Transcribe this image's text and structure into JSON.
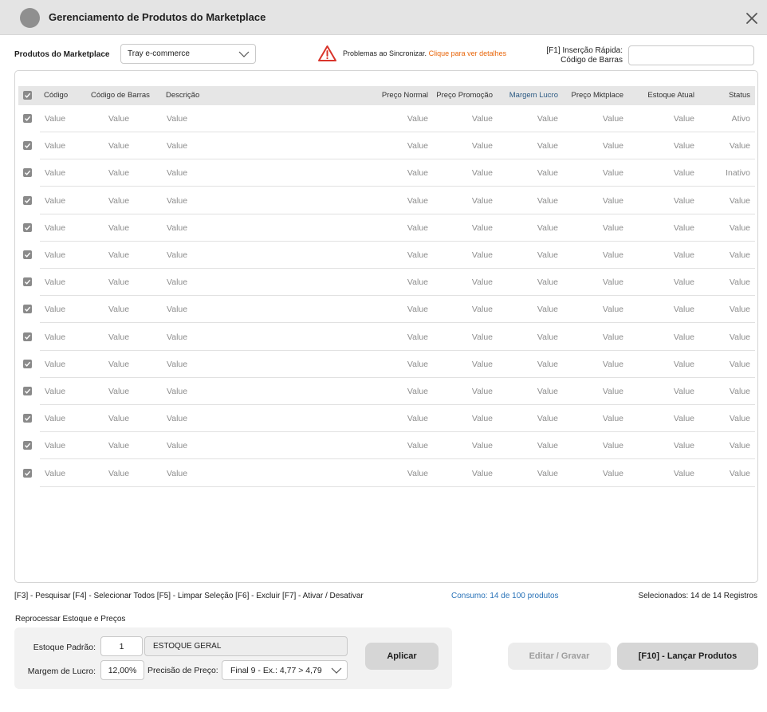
{
  "window": {
    "title": "Gerenciamento de Produtos do Marketplace"
  },
  "toolbar": {
    "marketplace_label": "Produtos do Marketplace",
    "marketplace_selected": "Tray e-commerce",
    "sync_warning": "Problemas ao Sincronizar.",
    "sync_link": "Clique para ver detalhes",
    "quick_insert_line1": "[F1] Inserção Rápida:",
    "quick_insert_line2": "Código de Barras",
    "quick_insert_value": ""
  },
  "table": {
    "columns": {
      "codigo": "Código",
      "codigo_barras": "Código de Barras",
      "descricao": "Descrição",
      "preco_normal": "Preço Normal",
      "preco_promocao": "Preço Promoção",
      "margem_lucro": "Margem Lucro",
      "preco_mktplace": "Preço Mktplace",
      "estoque_atual": "Estoque Atual",
      "status": "Status"
    },
    "rows": [
      {
        "checked": true,
        "codigo": "Value",
        "codigo_barras": "Value",
        "descricao": "Value",
        "preco_normal": "Value",
        "preco_promocao": "Value",
        "margem_lucro": "Value",
        "preco_mktplace": "Value",
        "estoque_atual": "Value",
        "status": "Ativo"
      },
      {
        "checked": true,
        "codigo": "Value",
        "codigo_barras": "Value",
        "descricao": "Value",
        "preco_normal": "Value",
        "preco_promocao": "Value",
        "margem_lucro": "Value",
        "preco_mktplace": "Value",
        "estoque_atual": "Value",
        "status": "Value"
      },
      {
        "checked": true,
        "codigo": "Value",
        "codigo_barras": "Value",
        "descricao": "Value",
        "preco_normal": "Value",
        "preco_promocao": "Value",
        "margem_lucro": "Value",
        "preco_mktplace": "Value",
        "estoque_atual": "Value",
        "status": "Inativo"
      },
      {
        "checked": true,
        "codigo": "Value",
        "codigo_barras": "Value",
        "descricao": "Value",
        "preco_normal": "Value",
        "preco_promocao": "Value",
        "margem_lucro": "Value",
        "preco_mktplace": "Value",
        "estoque_atual": "Value",
        "status": "Value"
      },
      {
        "checked": true,
        "codigo": "Value",
        "codigo_barras": "Value",
        "descricao": "Value",
        "preco_normal": "Value",
        "preco_promocao": "Value",
        "margem_lucro": "Value",
        "preco_mktplace": "Value",
        "estoque_atual": "Value",
        "status": "Value"
      },
      {
        "checked": true,
        "codigo": "Value",
        "codigo_barras": "Value",
        "descricao": "Value",
        "preco_normal": "Value",
        "preco_promocao": "Value",
        "margem_lucro": "Value",
        "preco_mktplace": "Value",
        "estoque_atual": "Value",
        "status": "Value"
      },
      {
        "checked": true,
        "codigo": "Value",
        "codigo_barras": "Value",
        "descricao": "Value",
        "preco_normal": "Value",
        "preco_promocao": "Value",
        "margem_lucro": "Value",
        "preco_mktplace": "Value",
        "estoque_atual": "Value",
        "status": "Value"
      },
      {
        "checked": true,
        "codigo": "Value",
        "codigo_barras": "Value",
        "descricao": "Value",
        "preco_normal": "Value",
        "preco_promocao": "Value",
        "margem_lucro": "Value",
        "preco_mktplace": "Value",
        "estoque_atual": "Value",
        "status": "Value"
      },
      {
        "checked": true,
        "codigo": "Value",
        "codigo_barras": "Value",
        "descricao": "Value",
        "preco_normal": "Value",
        "preco_promocao": "Value",
        "margem_lucro": "Value",
        "preco_mktplace": "Value",
        "estoque_atual": "Value",
        "status": "Value"
      },
      {
        "checked": true,
        "codigo": "Value",
        "codigo_barras": "Value",
        "descricao": "Value",
        "preco_normal": "Value",
        "preco_promocao": "Value",
        "margem_lucro": "Value",
        "preco_mktplace": "Value",
        "estoque_atual": "Value",
        "status": "Value"
      },
      {
        "checked": true,
        "codigo": "Value",
        "codigo_barras": "Value",
        "descricao": "Value",
        "preco_normal": "Value",
        "preco_promocao": "Value",
        "margem_lucro": "Value",
        "preco_mktplace": "Value",
        "estoque_atual": "Value",
        "status": "Value"
      },
      {
        "checked": true,
        "codigo": "Value",
        "codigo_barras": "Value",
        "descricao": "Value",
        "preco_normal": "Value",
        "preco_promocao": "Value",
        "margem_lucro": "Value",
        "preco_mktplace": "Value",
        "estoque_atual": "Value",
        "status": "Value"
      },
      {
        "checked": true,
        "codigo": "Value",
        "codigo_barras": "Value",
        "descricao": "Value",
        "preco_normal": "Value",
        "preco_promocao": "Value",
        "margem_lucro": "Value",
        "preco_mktplace": "Value",
        "estoque_atual": "Value",
        "status": "Value"
      },
      {
        "checked": true,
        "codigo": "Value",
        "codigo_barras": "Value",
        "descricao": "Value",
        "preco_normal": "Value",
        "preco_promocao": "Value",
        "margem_lucro": "Value",
        "preco_mktplace": "Value",
        "estoque_atual": "Value",
        "status": "Value"
      }
    ]
  },
  "footer": {
    "shortcuts": "[F3] - Pesquisar  [F4] - Selecionar Todos  [F5] - Limpar Seleção  [F6] - Excluir  [F7] - Ativar / Desativar",
    "consumo": "Consumo: 14 de 100 produtos",
    "selecionados": "Selecionados: 14 de 14 Registros"
  },
  "reprocess": {
    "title": "Reprocessar Estoque e Preços",
    "estoque_label": "Estoque Padrão:",
    "estoque_code": "1",
    "estoque_name": "ESTOQUE GERAL",
    "margem_label": "Margem de Lucro:",
    "margem_value": "12,00%",
    "precisao_label": "Precisão de Preço:",
    "precisao_selected": "Final 9 - Ex.: 4,77 > 4,79",
    "aplicar_label": "Aplicar"
  },
  "actions": {
    "editar_label": "Editar / Gravar",
    "lancar_label": "[F10] - Lançar Produtos"
  },
  "colors": {
    "warning_red": "#d9342b",
    "link_orange": "#e8650a",
    "consumo_blue": "#2a73b8",
    "header_blue": "#2d5b84"
  },
  "icons": {
    "close": "close-icon",
    "warning": "warning-triangle-icon",
    "chevron": "chevron-down-icon",
    "checkbox": "checkbox-checked-icon"
  }
}
